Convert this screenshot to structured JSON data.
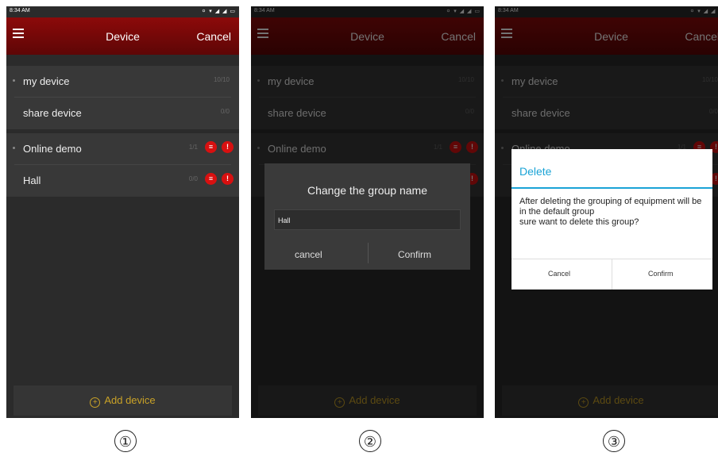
{
  "status": {
    "time": "8:34 AM",
    "icons": "⚪ ▾ ◢ ◢ ▭"
  },
  "header": {
    "title": "Device",
    "action": "Cancel"
  },
  "groups": [
    {
      "label": "my device",
      "count": "10/10"
    },
    {
      "label": "share device",
      "count": "0/0"
    },
    {
      "label": "Online demo",
      "count": "1/1"
    },
    {
      "label": "Hall",
      "count": "0/0"
    }
  ],
  "footer": {
    "add_label": "Add device"
  },
  "rename_dialog": {
    "title": "Change the group name",
    "value": "Hall",
    "cancel": "cancel",
    "confirm": "Confirm"
  },
  "delete_dialog": {
    "title": "Delete",
    "message": "After deleting the grouping of equipment will be in the default group\n sure want to delete this group?",
    "cancel": "Cancel",
    "confirm": "Confirm"
  },
  "steps": [
    "①",
    "②",
    "③"
  ],
  "colors": {
    "appbar": "#7a0808",
    "accent_gold": "#c9a227",
    "danger_red": "#d81010",
    "dialog_blue": "#1aa3d6"
  }
}
